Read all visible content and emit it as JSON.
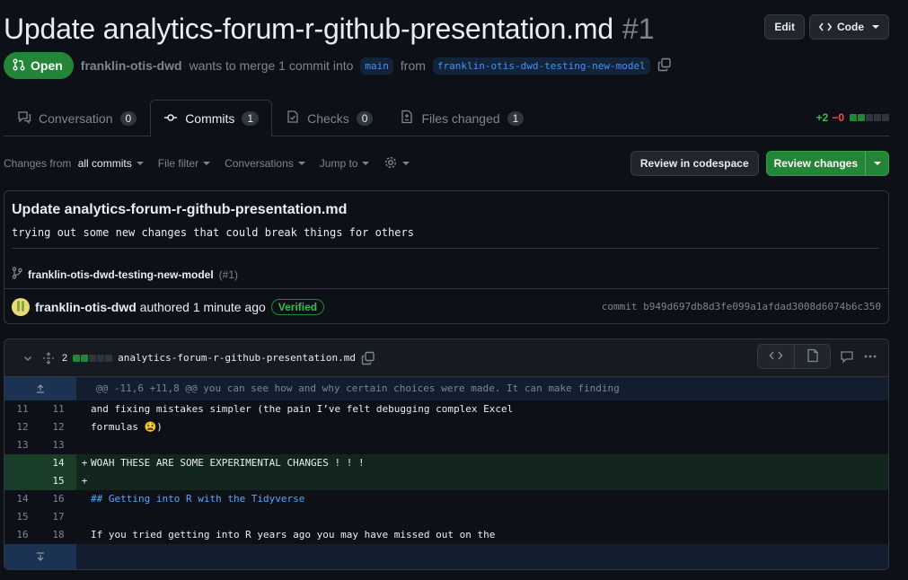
{
  "pr": {
    "title": "Update analytics-forum-r-github-presentation.md",
    "number": "#1",
    "edit_label": "Edit",
    "code_label": "Code",
    "state_label": "Open",
    "author": "franklin-otis-dwd",
    "merge_text_1": "wants to merge 1 commit into",
    "base_branch": "main",
    "merge_text_2": "from",
    "head_branch": "franklin-otis-dwd-testing-new-model"
  },
  "tabs": [
    {
      "label": "Conversation",
      "count": "0"
    },
    {
      "label": "Commits",
      "count": "1"
    },
    {
      "label": "Checks",
      "count": "0"
    },
    {
      "label": "Files changed",
      "count": "1"
    }
  ],
  "diffstat": {
    "additions": "+2",
    "deletions": "−0"
  },
  "toolbar": {
    "changes_prefix": "Changes from",
    "changes_value": "all commits",
    "file_filter": "File filter",
    "conversations": "Conversations",
    "jump_to": "Jump to",
    "review_codespace": "Review in codespace",
    "review_changes": "Review changes"
  },
  "commit": {
    "title": "Update analytics-forum-r-github-presentation.md",
    "description": "trying out some new changes that could break things for others",
    "branch": "franklin-otis-dwd-testing-new-model",
    "pr_ref": "(#1)",
    "author": "franklin-otis-dwd",
    "authored_text": "authored 1 minute ago",
    "verified": "Verified",
    "sha_label": "commit b949d697db8d3fe099a1afdad3008d6074b6c350"
  },
  "file": {
    "change_count": "2",
    "name": "analytics-forum-r-github-presentation.md",
    "hunk": "@@ -11,6 +11,8 @@ you can see how and why certain choices were made. It can make finding",
    "lines": [
      {
        "old": "11",
        "new": "11",
        "sign": " ",
        "text": "and fixing mistakes simpler (the pain I’ve felt debugging complex Excel"
      },
      {
        "old": "12",
        "new": "12",
        "sign": " ",
        "text": "formulas 😫)"
      },
      {
        "old": "13",
        "new": "13",
        "sign": " ",
        "text": ""
      },
      {
        "old": "",
        "new": "14",
        "sign": "+",
        "text": "WOAH THESE ARE SOME EXPERIMENTAL CHANGES ! ! !"
      },
      {
        "old": "",
        "new": "15",
        "sign": "+",
        "text": ""
      },
      {
        "old": "14",
        "new": "16",
        "sign": " ",
        "text": "## Getting into R with the Tidyverse"
      },
      {
        "old": "15",
        "new": "17",
        "sign": " ",
        "text": ""
      },
      {
        "old": "16",
        "new": "18",
        "sign": " ",
        "text": "If you tried getting into R years ago you may have missed out on the"
      }
    ]
  },
  "colors": {
    "accent_green": "#238636",
    "link_blue": "#4493f8",
    "bg": "#0d1117"
  }
}
